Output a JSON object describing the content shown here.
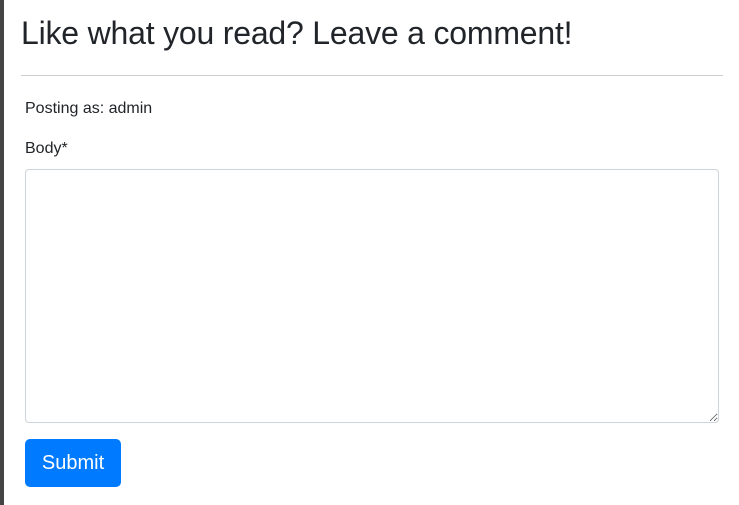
{
  "comment_form": {
    "heading": "Like what you read? Leave a comment!",
    "posting_as": "Posting as: admin",
    "body_label": "Body*",
    "body_value": "",
    "body_placeholder": "",
    "submit_label": "Submit"
  },
  "colors": {
    "primary_button": "#007bff",
    "text": "#212529",
    "divider": "#cfcfcf",
    "left_rule": "#444444"
  }
}
